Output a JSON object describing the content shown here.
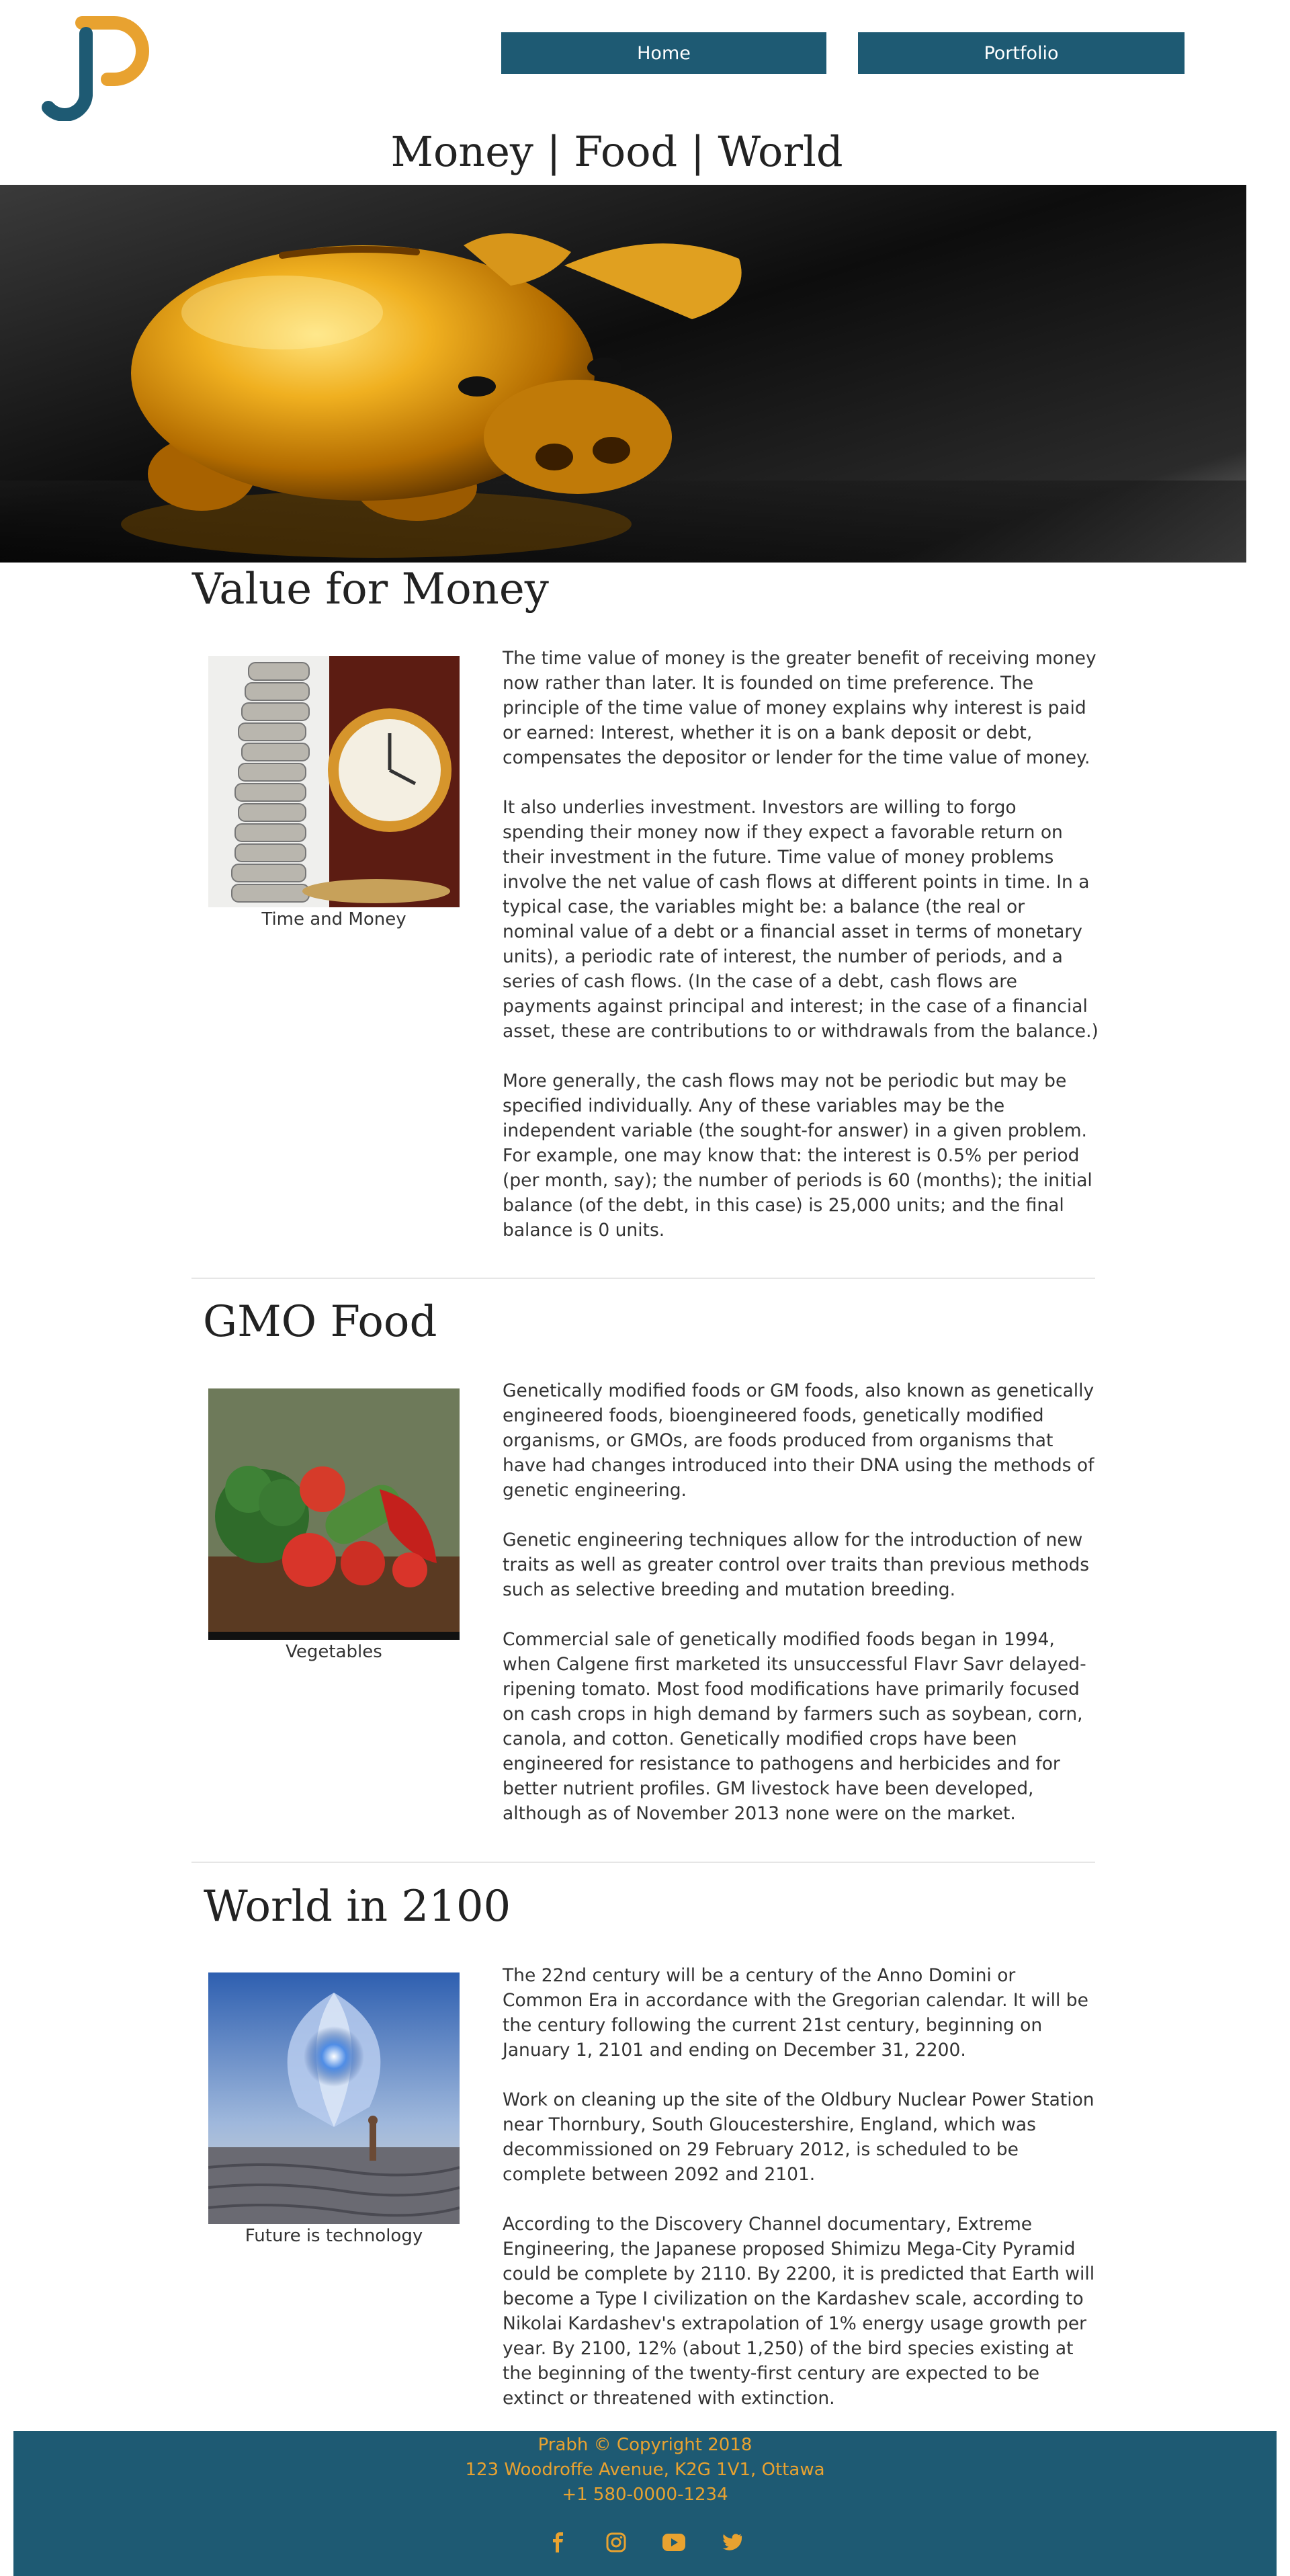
{
  "header": {
    "nav": {
      "home": "Home",
      "portfolio": "Portfolio"
    },
    "site_title": "Money | Food | World"
  },
  "sections": [
    {
      "title": "Value for Money",
      "image_caption": "Time and Money",
      "paragraphs": [
        "The time value of money is the greater benefit of receiving money now rather than later. It is founded on time preference. The principle of the time value of money explains why interest is paid or earned: Interest, whether it is on a bank deposit or debt, compensates the depositor or lender for the time value of money.",
        "It also underlies investment. Investors are willing to forgo spending their money now if they expect a favorable return on their investment in the future. Time value of money problems involve the net value of cash flows at different points in time. In a typical case, the variables might be: a balance (the real or nominal value of a debt or a financial asset in terms of monetary units), a periodic rate of interest, the number of periods, and a series of cash flows. (In the case of a debt, cash flows are payments against principal and interest; in the case of a financial asset, these are contributions to or withdrawals from the balance.)",
        "More generally, the cash flows may not be periodic but may be specified individually. Any of these variables may be the independent variable (the sought-for answer) in a given problem. For example, one may know that: the interest is 0.5% per period (per month, say); the number of periods is 60 (months); the initial balance (of the debt, in this case) is 25,000 units; and the final balance is 0 units."
      ]
    },
    {
      "title": "GMO Food",
      "image_caption": "Vegetables",
      "paragraphs": [
        "Genetically modified foods or GM foods, also known as genetically engineered foods, bioengineered foods, genetically modified organisms, or GMOs, are foods produced from organisms that have had changes introduced into their DNA using the methods of genetic engineering.",
        "Genetic engineering techniques allow for the introduction of new traits as well as greater control over traits than previous methods such as selective breeding and mutation breeding.",
        "Commercial sale of genetically modified foods began in 1994, when Calgene first marketed its unsuccessful Flavr Savr delayed-ripening tomato. Most food modifications have primarily focused on cash crops in high demand by farmers such as soybean, corn, canola, and cotton. Genetically modified crops have been engineered for resistance to pathogens and herbicides and for better nutrient profiles. GM livestock have been developed, although as of November 2013 none were on the market."
      ]
    },
    {
      "title": "World in 2100",
      "image_caption": "Future is technology",
      "paragraphs": [
        "The 22nd century will be a century of the Anno Domini or Common Era in accordance with the Gregorian calendar. It will be the century following the current 21st century, beginning on January 1, 2101 and ending on December 31, 2200.",
        "Work on cleaning up the site of the Oldbury Nuclear Power Station near Thornbury, South Gloucestershire, England, which was decommissioned on 29 February 2012, is scheduled to be complete between 2092 and 2101.",
        "According to the Discovery Channel documentary, Extreme Engineering, the Japanese proposed Shimizu Mega-City Pyramid could be complete by 2110. By 2200, it is predicted that Earth will become a Type I civilization on the Kardashev scale, according to Nikolai Kardashev's extrapolation of 1% energy usage growth per year. By 2100, 12% (about 1,250) of the bird species existing at the beginning of the twenty-first century are expected to be extinct or threatened with extinction."
      ]
    }
  ],
  "footer": {
    "copyright": "Prabh © Copyright 2018",
    "address": "123 Woodroffe Avenue, K2G 1V1, Ottawa",
    "phone": "+1 580-0000-1234",
    "social_icons": [
      "facebook-icon",
      "instagram-icon",
      "youtube-icon",
      "twitter-icon"
    ]
  },
  "colors": {
    "primary": "#1e5a73",
    "accent": "#e8a230"
  }
}
